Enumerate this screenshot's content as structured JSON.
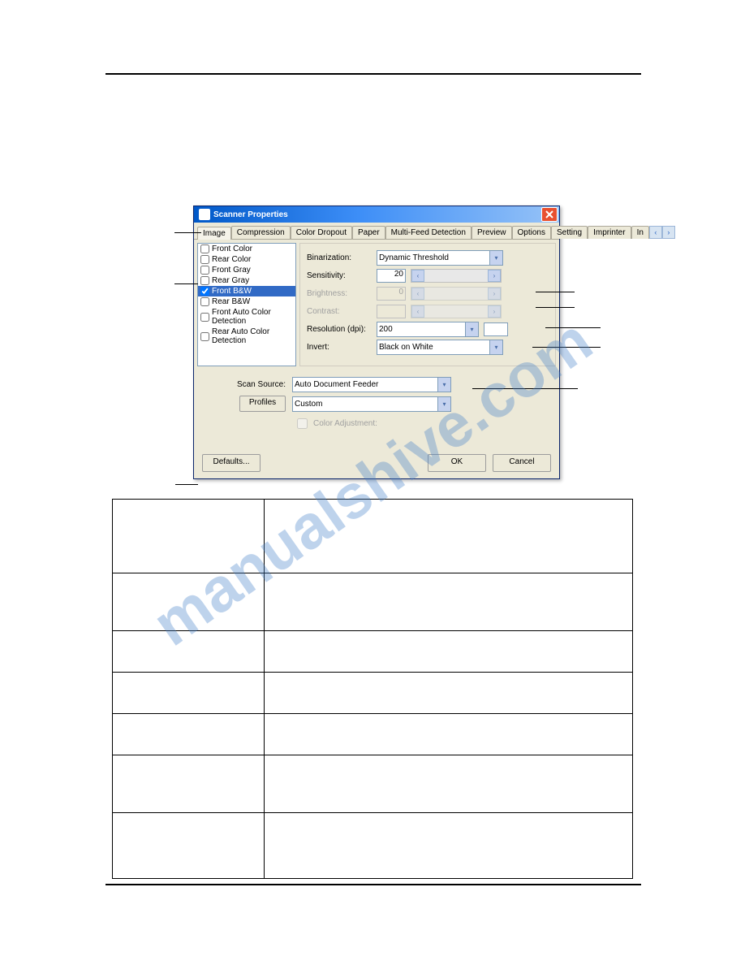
{
  "watermark": "manualshive.com",
  "dialog": {
    "title": "Scanner Properties",
    "tabs": [
      "Image",
      "Compression",
      "Color Dropout",
      "Paper",
      "Multi-Feed Detection",
      "Preview",
      "Options",
      "Setting",
      "Imprinter",
      "In"
    ],
    "listItems": [
      {
        "label": "Front Color",
        "checked": false,
        "selected": false
      },
      {
        "label": "Rear Color",
        "checked": false,
        "selected": false
      },
      {
        "label": "Front Gray",
        "checked": false,
        "selected": false
      },
      {
        "label": "Rear Gray",
        "checked": false,
        "selected": false
      },
      {
        "label": "Front B&W",
        "checked": true,
        "selected": true
      },
      {
        "label": "Rear B&W",
        "checked": false,
        "selected": false
      },
      {
        "label": "Front Auto Color Detection",
        "checked": false,
        "selected": false
      },
      {
        "label": "Rear Auto Color Detection",
        "checked": false,
        "selected": false
      }
    ],
    "settings": {
      "binarization_label": "Binarization:",
      "binarization_value": "Dynamic Threshold",
      "sensitivity_label": "Sensitivity:",
      "sensitivity_value": "20",
      "brightness_label": "Brightness:",
      "brightness_value": "0",
      "contrast_label": "Contrast:",
      "contrast_value": "",
      "resolution_label": "Resolution (dpi):",
      "resolution_value": "200",
      "invert_label": "Invert:",
      "invert_value": "Black on White"
    },
    "scanSource": {
      "label": "Scan Source:",
      "value": "Auto Document Feeder"
    },
    "profiles": {
      "button": "Profiles",
      "value": "Custom"
    },
    "colorAdjustment": "Color Adjustment:",
    "buttons": {
      "defaults": "Defaults...",
      "ok": "OK",
      "cancel": "Cancel"
    }
  }
}
